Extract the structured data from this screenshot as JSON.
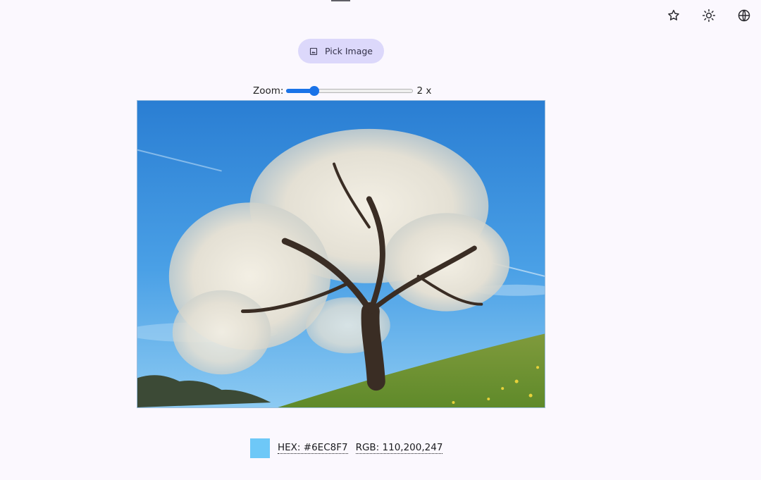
{
  "toolbar": {
    "icons": [
      "star-icon",
      "sun-icon",
      "globe-icon"
    ]
  },
  "picker": {
    "button_label": "Pick Image",
    "button_icon": "image-icon",
    "button_color": "#dcd8fb"
  },
  "zoom": {
    "label": "Zoom:",
    "value_text": "2 x",
    "level_fraction": 0.22,
    "accent": "#1a73e8"
  },
  "picked_color": {
    "swatch": "#6EC8F7",
    "hex_text": "HEX: #6EC8F7",
    "rgb_text": "RGB: 110,200,247"
  }
}
